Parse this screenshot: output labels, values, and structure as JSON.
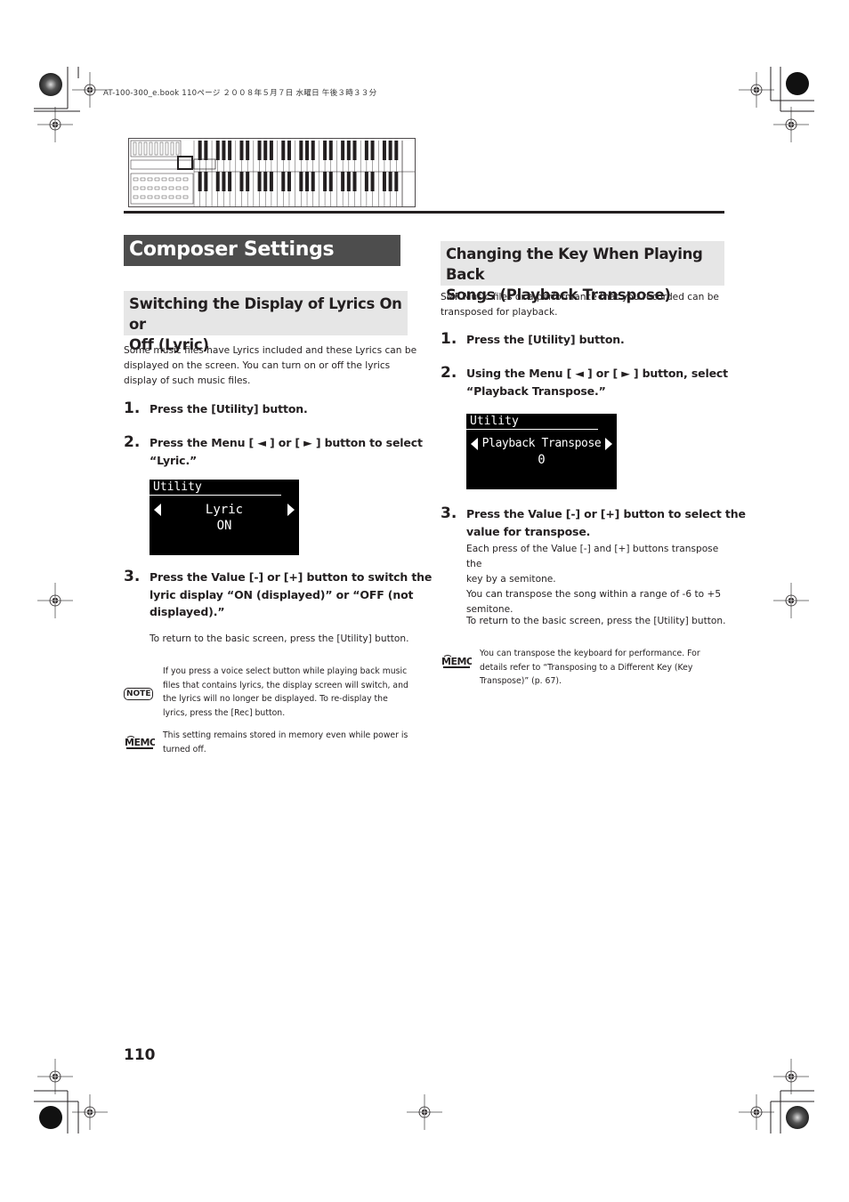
{
  "print_info": "AT-100-300_e.book  110ページ  ２００８年５月７日  水曜日  午後３時３３分",
  "illustration": {
    "name": "organ-keyboard-illustration"
  },
  "left": {
    "main_title": "Composer Settings",
    "section_title_line1": "Switching the Display of Lyrics On or",
    "section_title_line2": "Off (Lyric)",
    "intro": [
      "Some music files have Lyrics included and these Lyrics can be",
      "displayed on the screen. You can turn on or off the lyrics",
      "display of such music files."
    ],
    "steps": [
      {
        "num": "1.",
        "lines": [
          "Press the [Utility] button."
        ]
      },
      {
        "num": "2.",
        "lines": [
          "Press the Menu [ ◄ ] or [ ► ] button to select",
          "“Lyric.”"
        ]
      },
      {
        "num": "3.",
        "lines": [
          "Press the Value [-] or [+] button to switch the",
          "lyric display “ON (displayed)” or “OFF (not",
          "displayed).”"
        ]
      }
    ],
    "screen": {
      "title": "Utility",
      "line1": "Lyric",
      "line2": "ON"
    },
    "return_text": "To return to the basic screen, press the [Utility] button.",
    "note": {
      "icon_label": "NOTE",
      "lines": [
        "If you press a voice select button while playing back music",
        "files that contains lyrics, the display screen will switch, and",
        "the lyrics will no longer be displayed. To re-display the",
        "lyrics, press the [Rec] button."
      ]
    },
    "memo": {
      "icon_label": "MEMO",
      "lines": [
        "This setting remains stored in memory even while power is",
        "turned off."
      ]
    }
  },
  "right": {
    "section_title_line1": "Changing the Key When Playing Back",
    "section_title_line2": "Songs (Playback Transpose)",
    "intro": [
      "SMF Music files or a performance that you recorded can be",
      "transposed for playback."
    ],
    "steps": [
      {
        "num": "1.",
        "lines": [
          "Press the [Utility] button."
        ]
      },
      {
        "num": "2.",
        "lines": [
          "Using the Menu [ ◄ ] or [ ► ] button, select",
          "“Playback Transpose.”"
        ]
      },
      {
        "num": "3.",
        "lines": [
          "Press the Value [-] or [+] button to select the",
          "value for transpose."
        ]
      }
    ],
    "screen": {
      "title": "Utility",
      "line1": "Playback Transpose",
      "line2": "0"
    },
    "step3_detail": [
      "Each press of the Value [-] and [+] buttons transpose the",
      "key by a semitone.",
      "You can transpose the song within a range of -6 to +5",
      "semitone."
    ],
    "return_text": "To return to the basic screen, press the [Utility] button.",
    "memo": {
      "icon_label": "MEMO",
      "lines": [
        "You can transpose the keyboard for performance. For",
        "details refer to “Transposing to a Different Key (Key",
        "Transpose)” (p. 67)."
      ]
    }
  },
  "page_number": "110"
}
